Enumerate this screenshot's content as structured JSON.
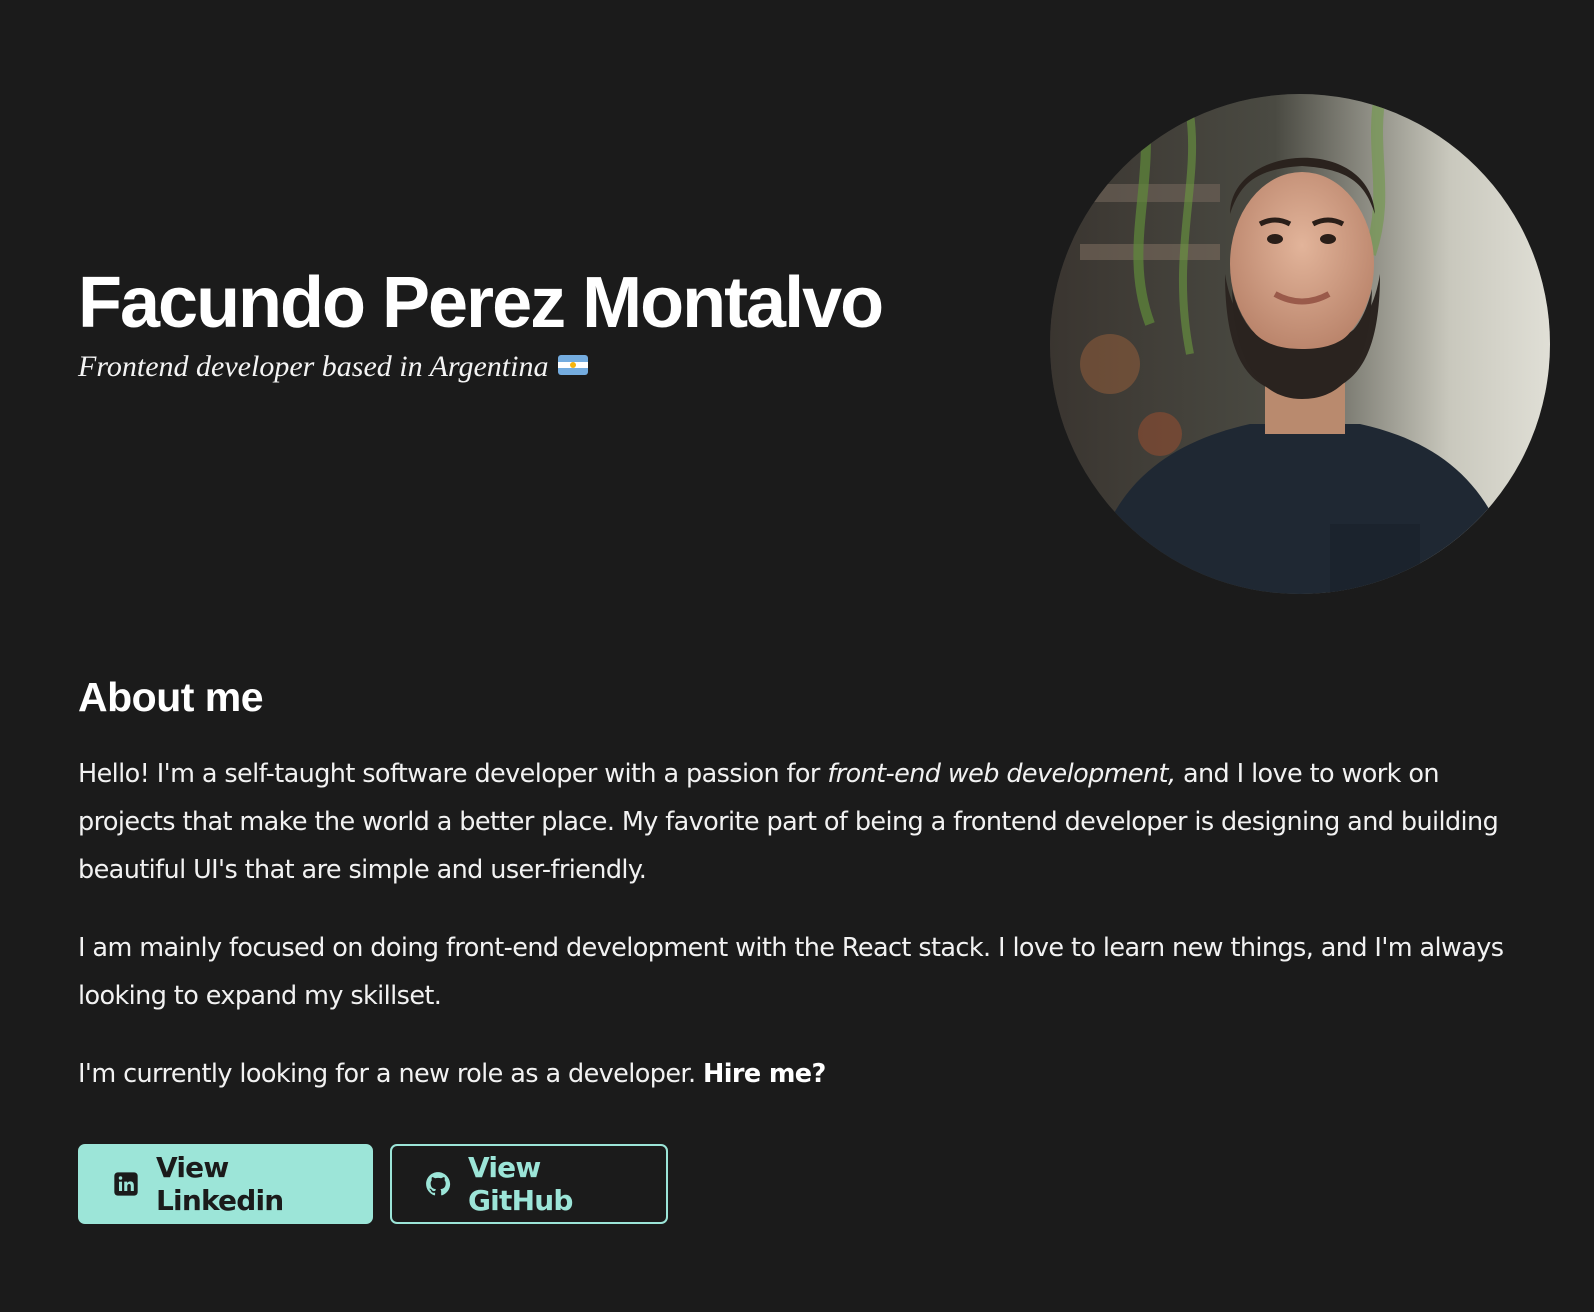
{
  "hero": {
    "name": "Facundo Perez Montalvo",
    "tagline": "Frontend developer based in Argentina",
    "flag_icon": "argentina-flag-icon"
  },
  "about": {
    "title": "About me",
    "p1_before": "Hello! I'm a self-taught software developer with a passion for ",
    "p1_em": "front-end web development,",
    "p1_after": " and I love to work on projects that make the world a better place. My favorite part of being a frontend developer is designing and building beautiful UI's that are simple and user-friendly.",
    "p2": "I am mainly focused on doing front-end development with the React stack. I love to learn new things, and I'm always looking to expand my skillset.",
    "p3_before": "I'm currently looking for a new role as a developer. ",
    "p3_strong": "Hire me?"
  },
  "buttons": {
    "linkedin_label": "View Linkedin",
    "linkedin_icon": "linkedin-icon",
    "github_label": "View GitHub",
    "github_icon": "github-icon"
  },
  "colors": {
    "background": "#1b1b1b",
    "accent": "#9ce5d8",
    "text": "#ffffff"
  }
}
